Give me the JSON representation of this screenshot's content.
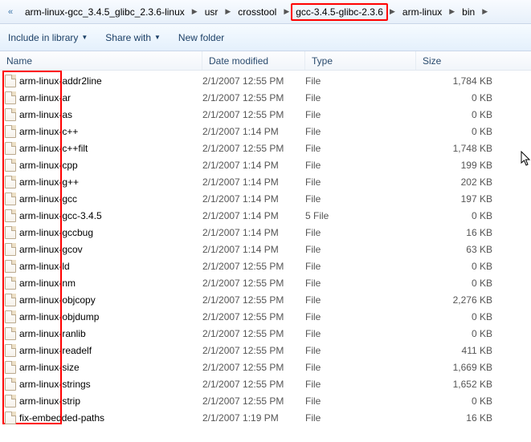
{
  "breadcrumbs": {
    "overflow": "«",
    "items": [
      {
        "label": "arm-linux-gcc_3.4.5_glibc_2.3.6-linux",
        "highlight": false
      },
      {
        "label": "usr",
        "highlight": false
      },
      {
        "label": "crosstool",
        "highlight": false
      },
      {
        "label": "gcc-3.4.5-glibc-2.3.6",
        "highlight": true
      },
      {
        "label": "arm-linux",
        "highlight": false
      },
      {
        "label": "bin",
        "highlight": false
      }
    ]
  },
  "toolbar": {
    "include": "Include in library",
    "share": "Share with",
    "newfolder": "New folder"
  },
  "columns": {
    "name": "Name",
    "date": "Date modified",
    "type": "Type",
    "size": "Size"
  },
  "files": [
    {
      "name": "arm-linux-addr2line",
      "date": "2/1/2007 12:55 PM",
      "type": "File",
      "size": "1,784 KB"
    },
    {
      "name": "arm-linux-ar",
      "date": "2/1/2007 12:55 PM",
      "type": "File",
      "size": "0 KB"
    },
    {
      "name": "arm-linux-as",
      "date": "2/1/2007 12:55 PM",
      "type": "File",
      "size": "0 KB"
    },
    {
      "name": "arm-linux-c++",
      "date": "2/1/2007 1:14 PM",
      "type": "File",
      "size": "0 KB"
    },
    {
      "name": "arm-linux-c++filt",
      "date": "2/1/2007 12:55 PM",
      "type": "File",
      "size": "1,748 KB"
    },
    {
      "name": "arm-linux-cpp",
      "date": "2/1/2007 1:14 PM",
      "type": "File",
      "size": "199 KB"
    },
    {
      "name": "arm-linux-g++",
      "date": "2/1/2007 1:14 PM",
      "type": "File",
      "size": "202 KB"
    },
    {
      "name": "arm-linux-gcc",
      "date": "2/1/2007 1:14 PM",
      "type": "File",
      "size": "197 KB"
    },
    {
      "name": "arm-linux-gcc-3.4.5",
      "date": "2/1/2007 1:14 PM",
      "type": "5 File",
      "size": "0 KB"
    },
    {
      "name": "arm-linux-gccbug",
      "date": "2/1/2007 1:14 PM",
      "type": "File",
      "size": "16 KB"
    },
    {
      "name": "arm-linux-gcov",
      "date": "2/1/2007 1:14 PM",
      "type": "File",
      "size": "63 KB"
    },
    {
      "name": "arm-linux-ld",
      "date": "2/1/2007 12:55 PM",
      "type": "File",
      "size": "0 KB"
    },
    {
      "name": "arm-linux-nm",
      "date": "2/1/2007 12:55 PM",
      "type": "File",
      "size": "0 KB"
    },
    {
      "name": "arm-linux-objcopy",
      "date": "2/1/2007 12:55 PM",
      "type": "File",
      "size": "2,276 KB"
    },
    {
      "name": "arm-linux-objdump",
      "date": "2/1/2007 12:55 PM",
      "type": "File",
      "size": "0 KB"
    },
    {
      "name": "arm-linux-ranlib",
      "date": "2/1/2007 12:55 PM",
      "type": "File",
      "size": "0 KB"
    },
    {
      "name": "arm-linux-readelf",
      "date": "2/1/2007 12:55 PM",
      "type": "File",
      "size": "411 KB"
    },
    {
      "name": "arm-linux-size",
      "date": "2/1/2007 12:55 PM",
      "type": "File",
      "size": "1,669 KB"
    },
    {
      "name": "arm-linux-strings",
      "date": "2/1/2007 12:55 PM",
      "type": "File",
      "size": "1,652 KB"
    },
    {
      "name": "arm-linux-strip",
      "date": "2/1/2007 12:55 PM",
      "type": "File",
      "size": "0 KB"
    },
    {
      "name": "fix-embedded-paths",
      "date": "2/1/2007 1:19 PM",
      "type": "File",
      "size": "16 KB"
    }
  ]
}
